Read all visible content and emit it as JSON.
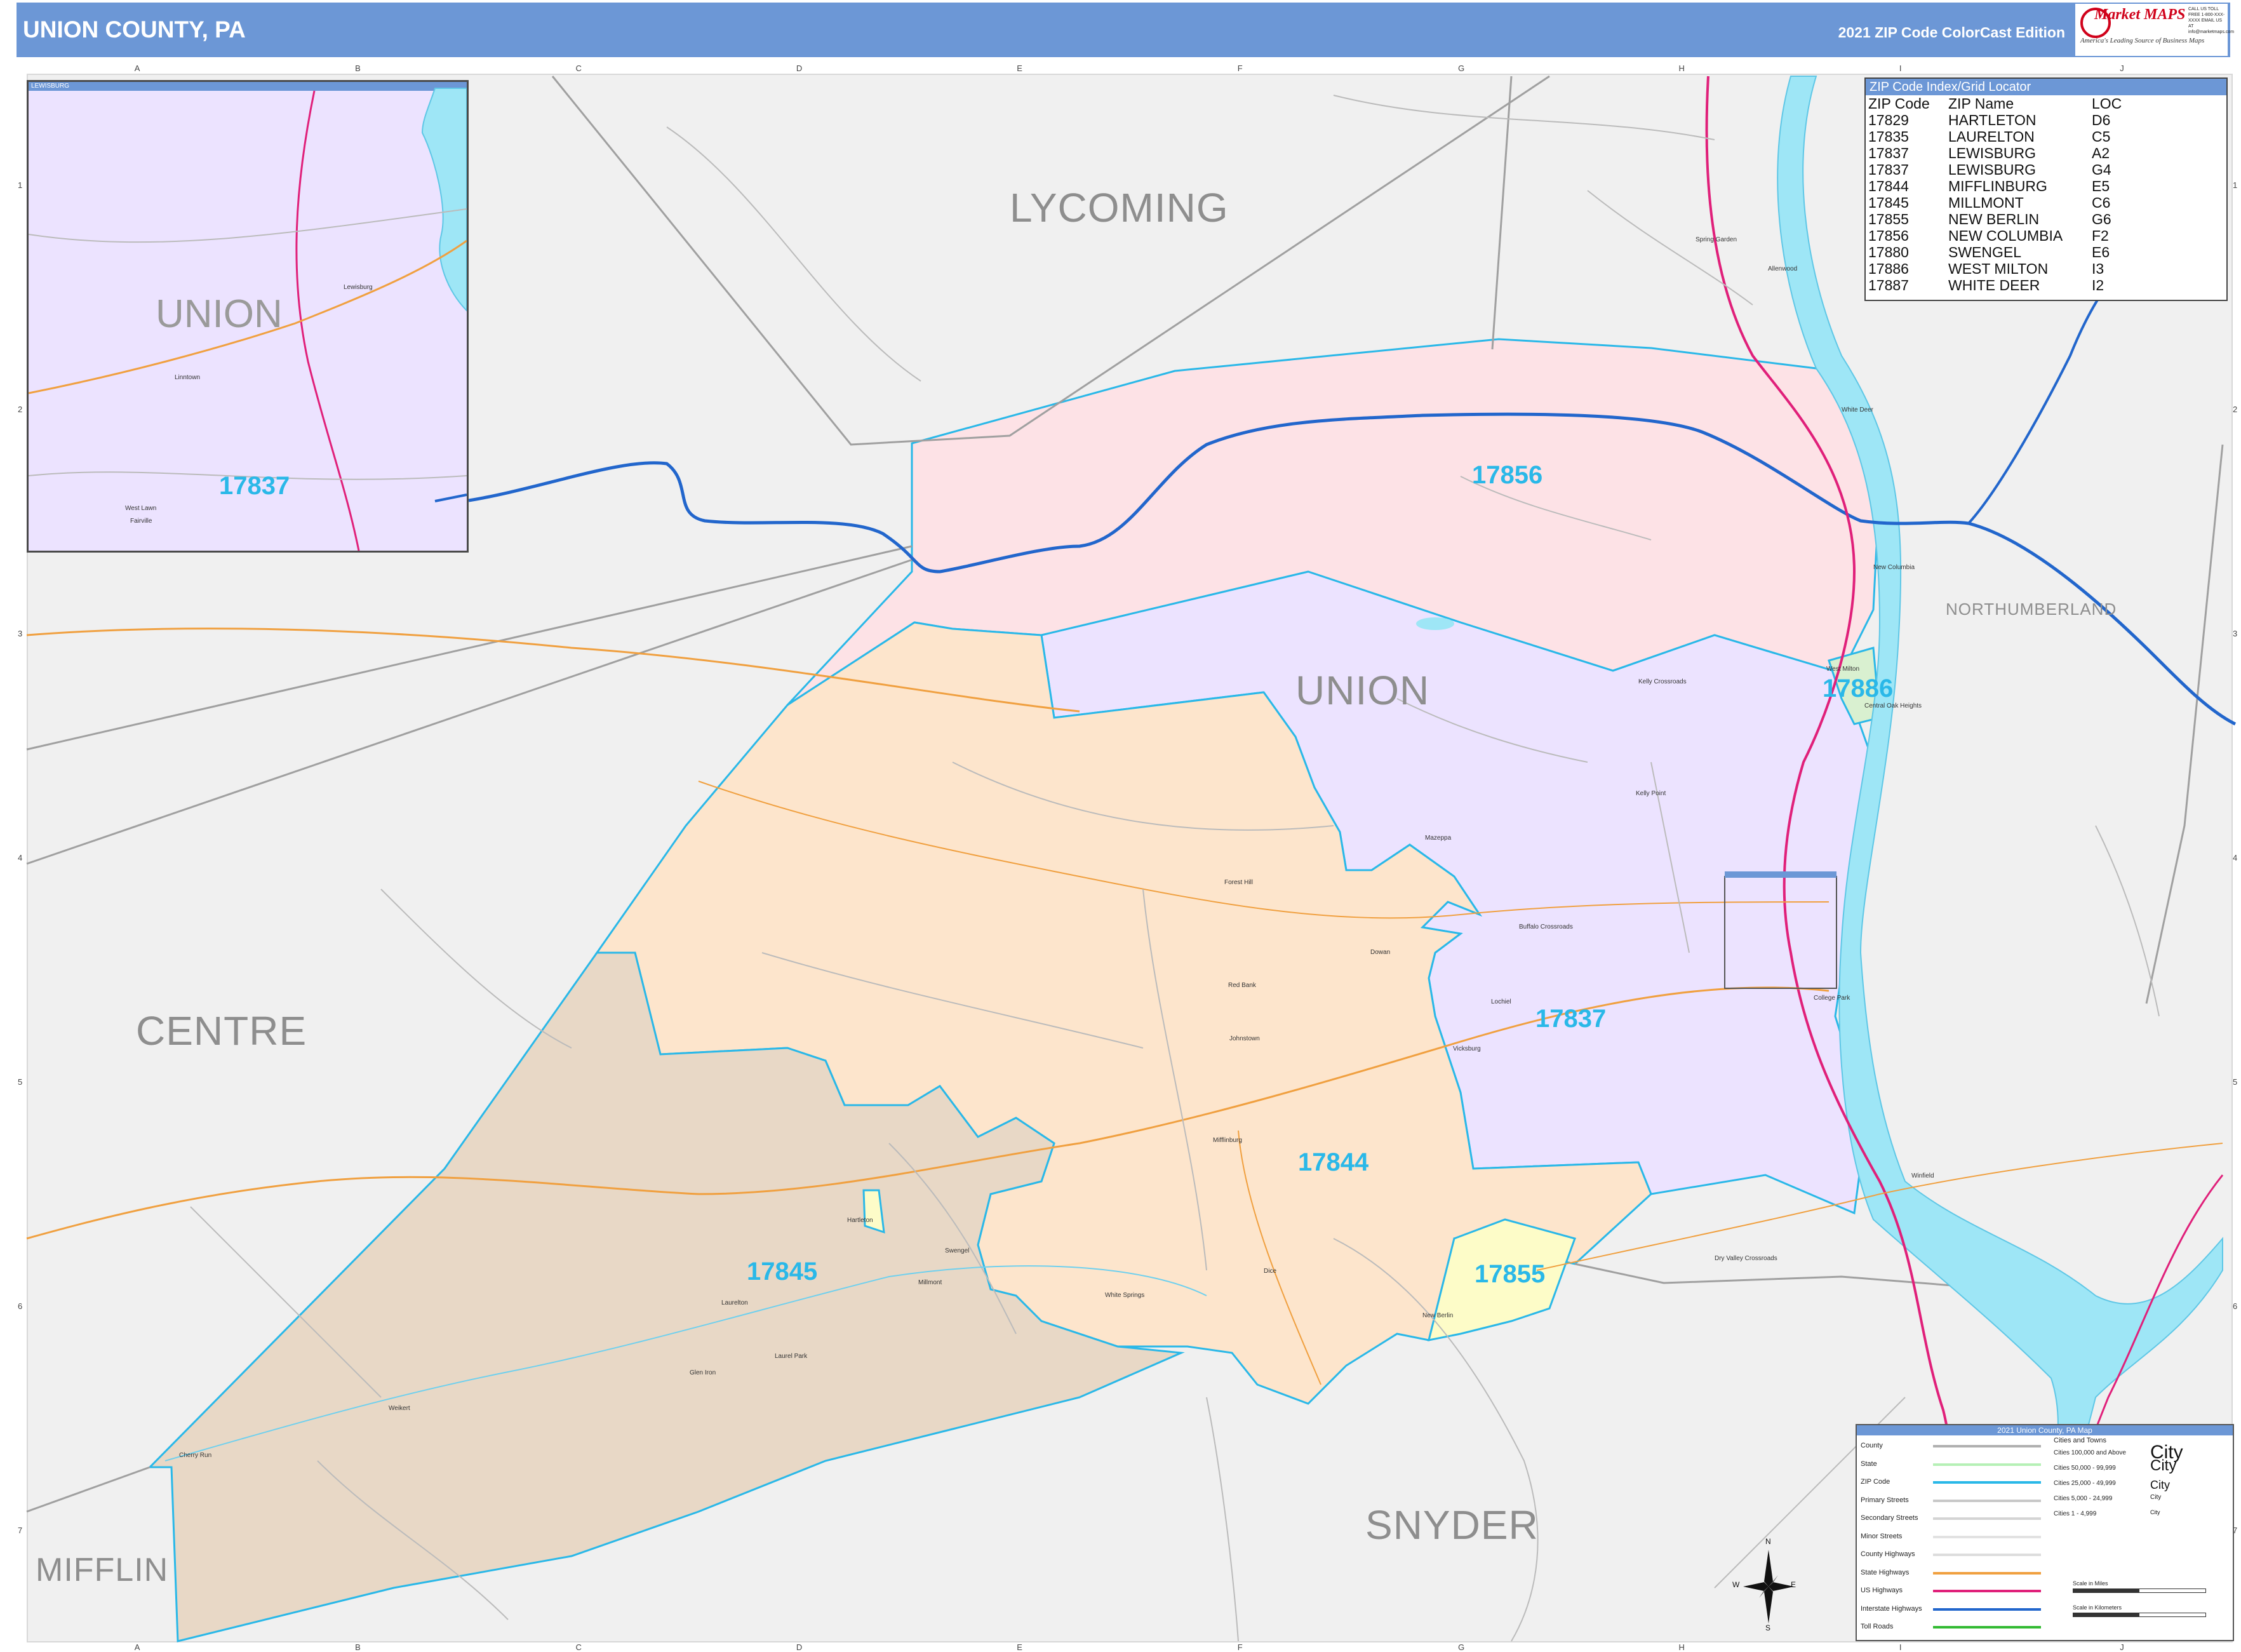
{
  "header": {
    "title": "UNION COUNTY, PA",
    "edition": "2021 ZIP Code ColorCast Edition"
  },
  "logo": {
    "name": "Market MAPS",
    "tagline": "America's Leading Source of Business Maps",
    "contact": "CALL US TOLL FREE 1-800-XXX-XXXX EMAIL US AT info@marketmaps.com"
  },
  "grid": {
    "columns": [
      "A",
      "B",
      "C",
      "D",
      "E",
      "F",
      "G",
      "H",
      "I",
      "J"
    ],
    "rows": [
      "1",
      "2",
      "3",
      "4",
      "5",
      "6",
      "7"
    ]
  },
  "counties": {
    "union": "UNION",
    "lycoming": "LYCOMING",
    "centre": "CENTRE",
    "snyder": "SNYDER",
    "mifflin": "MIFFLIN",
    "northumberland": "NORTHUMBERLAND"
  },
  "zips": {
    "z17856": "17856",
    "z17837": "17837",
    "z17844": "17844",
    "z17845": "17845",
    "z17855": "17855",
    "z17886": "17886"
  },
  "places": {
    "spring_garden": "Spring Garden",
    "allenwood": "Allenwood",
    "white_deer": "White Deer",
    "new_columbia": "New Columbia",
    "kelly_crossroads": "Kelly Crossroads",
    "west_milton": "West Milton",
    "central_oak_heights": "Central Oak Heights",
    "kelly_point": "Kelly Point",
    "mazeppa": "Mazeppa",
    "forest_hill": "Forest Hill",
    "buffalo_crossroads": "Buffalo Crossroads",
    "dowan": "Dowan",
    "red_bank": "Red Bank",
    "johnstown": "Johnstown",
    "lochiel": "Lochiel",
    "vicksburg": "Vicksburg",
    "college_park": "College Park",
    "mifflinburg": "Mifflinburg",
    "winfield": "Winfield",
    "hartleton": "Hartleton",
    "swengel": "Swengel",
    "millmont": "Millmont",
    "laurelton": "Laurelton",
    "white_springs": "White Springs",
    "dice": "Dice",
    "dry_valley_crossroads": "Dry Valley Crossroads",
    "new_berlin": "New Berlin",
    "laurel_park": "Laurel Park",
    "glen_iron": "Glen Iron",
    "weikert": "Weikert",
    "cherry_run": "Cherry Run"
  },
  "inset": {
    "title": "LEWISBURG",
    "county": "UNION",
    "zip": "17837",
    "places": {
      "lewisburg": "Lewisburg",
      "linntown": "Linntown",
      "west_lawn": "West Lawn",
      "fairville": "Fairville"
    }
  },
  "zip_index": {
    "title": "ZIP Code Index/Grid Locator",
    "headers": [
      "ZIP Code",
      "ZIP Name",
      "LOC"
    ],
    "rows": [
      [
        "17829",
        "HARTLETON",
        "D6"
      ],
      [
        "17835",
        "LAURELTON",
        "C5"
      ],
      [
        "17837",
        "LEWISBURG",
        "A2"
      ],
      [
        "17837",
        "LEWISBURG",
        "G4"
      ],
      [
        "17844",
        "MIFFLINBURG",
        "E5"
      ],
      [
        "17845",
        "MILLMONT",
        "C6"
      ],
      [
        "17855",
        "NEW BERLIN",
        "G6"
      ],
      [
        "17856",
        "NEW COLUMBIA",
        "F2"
      ],
      [
        "17880",
        "SWENGEL",
        "E6"
      ],
      [
        "17886",
        "WEST MILTON",
        "I3"
      ],
      [
        "17887",
        "WHITE DEER",
        "I2"
      ]
    ]
  },
  "legend": {
    "title": "2021 Union County, PA Map",
    "items": [
      {
        "label": "County",
        "color": "#b0b0b0"
      },
      {
        "label": "State",
        "color": "#b6f0b6"
      },
      {
        "label": "ZIP Code",
        "color": "#2ab8e8"
      },
      {
        "label": "Primary Streets",
        "color": "#c8c8c8"
      },
      {
        "label": "Secondary Streets",
        "color": "#d4d4d4"
      },
      {
        "label": "Minor Streets",
        "color": "#e2e2e2"
      },
      {
        "label": "County Highways",
        "color": "#dddddd"
      },
      {
        "label": "State Highways",
        "color": "#f0a040"
      },
      {
        "label": "US Highways",
        "color": "#e0207a"
      },
      {
        "label": "Interstate Highways",
        "color": "#2266cc"
      },
      {
        "label": "Toll Roads",
        "color": "#33bb33"
      }
    ],
    "cities_header": "Cities and Towns",
    "cities": [
      {
        "label": "Cities 100,000 and Above",
        "sample": "City"
      },
      {
        "label": "Cities 50,000 - 99,999",
        "sample": "City"
      },
      {
        "label": "Cities 25,000 - 49,999",
        "sample": "City"
      },
      {
        "label": "Cities 5,000 - 24,999",
        "sample": "City"
      },
      {
        "label": "Cities 1 - 4,999",
        "sample": "City"
      }
    ],
    "scale_miles": "Scale in Miles",
    "scale_km": "Scale in Kilometers"
  },
  "compass": {
    "n": "N",
    "s": "S",
    "e": "E",
    "w": "W"
  },
  "colors": {
    "z17856": "#fde2e6",
    "z17837": "#ece3ff",
    "z17844": "#fde5cc",
    "z17845": "#e8d8c6",
    "z17855": "#fdfcc8",
    "z17886": "#d9f0d0",
    "river": "#9ee6f6",
    "interstate": "#2266cc",
    "us_highway": "#e0207a",
    "state_highway": "#f0a040",
    "zip_border": "#2ab8e8",
    "county_border": "#a0a0a0",
    "header": "#6c97d6"
  }
}
